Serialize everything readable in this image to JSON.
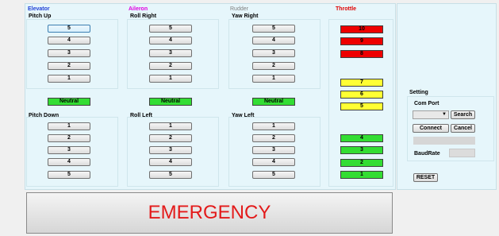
{
  "groups": {
    "elevator": {
      "title": "Elevator",
      "color": "#1f3fd6",
      "upper_label": "Pitch Up",
      "upper_values": [
        "5",
        "4",
        "3",
        "2",
        "1"
      ],
      "neutral": "Neutral",
      "lower_label": "Pitch Down",
      "lower_values": [
        "1",
        "2",
        "3",
        "4",
        "5"
      ]
    },
    "aileron": {
      "title": "Aileron",
      "color": "#e000e0",
      "upper_label": "Roll Right",
      "upper_values": [
        "5",
        "4",
        "3",
        "2",
        "1"
      ],
      "neutral": "Neutral",
      "lower_label": "Roll Left",
      "lower_values": [
        "1",
        "2",
        "3",
        "4",
        "5"
      ]
    },
    "rudder": {
      "title": "Rudder",
      "color": "#808080",
      "upper_label": "Yaw Right",
      "upper_values": [
        "5",
        "4",
        "3",
        "2",
        "1"
      ],
      "neutral": "Neutral",
      "lower_label": "Yaw Left",
      "lower_values": [
        "1",
        "2",
        "3",
        "4",
        "5"
      ]
    }
  },
  "throttle": {
    "title": "Throttle",
    "color": "#e00000",
    "levels": [
      {
        "label": "10",
        "color": "#ee0000"
      },
      {
        "label": "9",
        "color": "#ee0000"
      },
      {
        "label": "8",
        "color": "#ee0000"
      },
      {
        "label": "7",
        "color": "#ffff33"
      },
      {
        "label": "6",
        "color": "#ffff33"
      },
      {
        "label": "5",
        "color": "#ffff33"
      },
      {
        "label": "4",
        "color": "#33dd33"
      },
      {
        "label": "3",
        "color": "#33dd33"
      },
      {
        "label": "2",
        "color": "#33dd33"
      },
      {
        "label": "1",
        "color": "#33dd33"
      }
    ]
  },
  "setting": {
    "title": "Setting",
    "com_port_label": "Com Port",
    "com_port_value": "",
    "search_label": "Search",
    "connect_label": "Connect",
    "cancel_label": "Cancel",
    "status_text": "",
    "baudrate_label": "BaudRate",
    "baudrate_value": "",
    "reset_label": "RESET"
  },
  "emergency": {
    "label": "EMERGENCY",
    "color": "#e31a1a"
  }
}
